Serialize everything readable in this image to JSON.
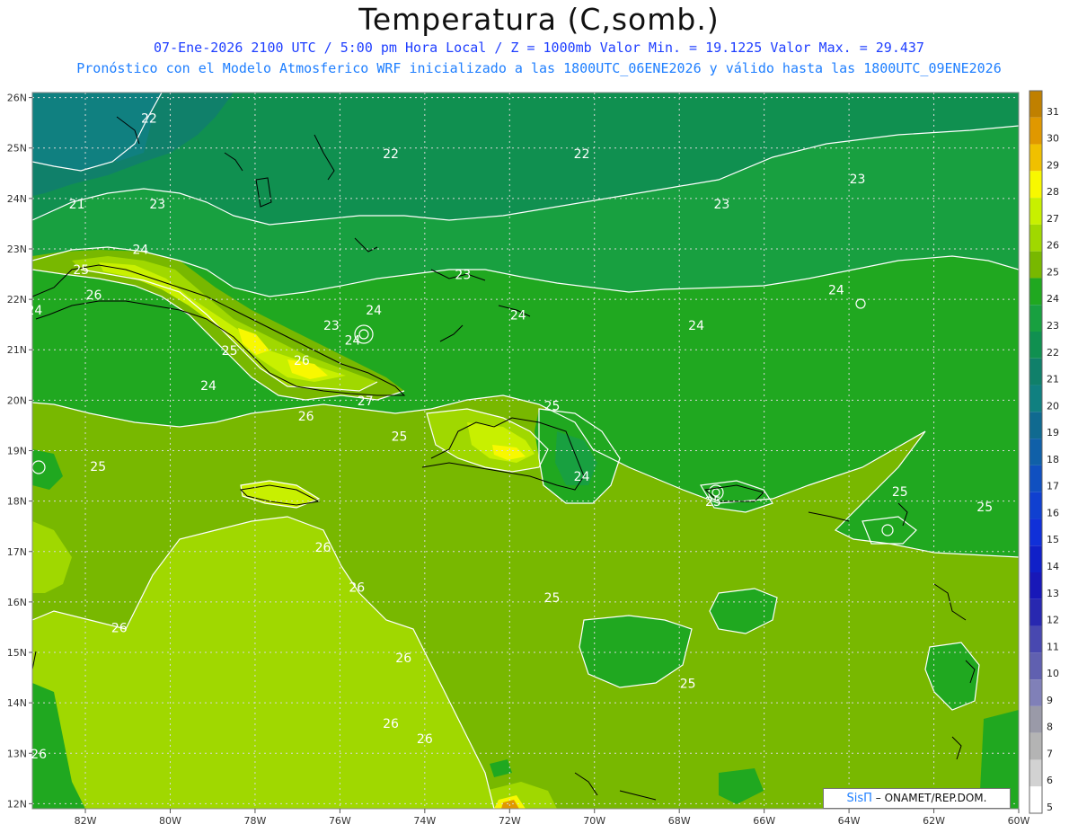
{
  "title": "Temperatura (C,somb.)",
  "subtitle_line1": "07-Ene-2026  2100 UTC / 5:00 pm Hora Local / Z = 1000mb    Valor Min. = 19.1225  Valor Max. = 29.437",
  "subtitle_line2": "Pronóstico con el Modelo Atmosferico WRF inicializado a las 1800UTC_06ENE2026 y válido hasta las  1800UTC_09ENE2026",
  "credit": {
    "brand": "SisΠ",
    "text": "– ONAMET/REP.DOM."
  },
  "lat_labels": [
    "26N",
    "25N",
    "24N",
    "23N",
    "22N",
    "21N",
    "20N",
    "19N",
    "18N",
    "17N",
    "16N",
    "15N",
    "14N",
    "13N",
    "12N"
  ],
  "lon_labels": [
    "82W",
    "80W",
    "78W",
    "76W",
    "74W",
    "72W",
    "70W",
    "68W",
    "66W",
    "64W",
    "62W",
    "60W"
  ],
  "colorbar": {
    "labels": [
      "31",
      "30",
      "29",
      "28",
      "27",
      "26",
      "25",
      "24",
      "23",
      "22",
      "21",
      "20",
      "19",
      "18",
      "17",
      "16",
      "15",
      "14",
      "13",
      "12",
      "11",
      "10",
      "9",
      "8",
      "7",
      "6",
      "5"
    ],
    "colors": [
      "#c08000",
      "#e09800",
      "#f0c000",
      "#f8f800",
      "#c8f000",
      "#a0d800",
      "#78b800",
      "#20a820",
      "#18a040",
      "#109050",
      "#10806a",
      "#108080",
      "#106a90",
      "#1060a8",
      "#1050c0",
      "#1040d0",
      "#1030d8",
      "#1020c8",
      "#1818b8",
      "#2828b0",
      "#4848b0",
      "#6060b0",
      "#8080b8",
      "#9a9aa8",
      "#b4b4b4",
      "#d2d2d2",
      "#ffffff"
    ]
  },
  "contour_labels": [
    {
      "t": "22",
      "lat": 25.5,
      "lon": -80.5
    },
    {
      "t": "22",
      "lat": 24.8,
      "lon": -74.8
    },
    {
      "t": "22",
      "lat": 24.8,
      "lon": -70.3
    },
    {
      "t": "21",
      "lat": 23.8,
      "lon": -82.2
    },
    {
      "t": "23",
      "lat": 23.8,
      "lon": -80.3
    },
    {
      "t": "23",
      "lat": 23.8,
      "lon": -67.0
    },
    {
      "t": "23",
      "lat": 24.3,
      "lon": -63.8
    },
    {
      "t": "23",
      "lat": 22.4,
      "lon": -73.1
    },
    {
      "t": "24",
      "lat": 22.9,
      "lon": -80.7
    },
    {
      "t": "25",
      "lat": 22.5,
      "lon": -82.1
    },
    {
      "t": "26",
      "lat": 22.0,
      "lon": -81.8
    },
    {
      "t": "24",
      "lat": 21.7,
      "lon": -83.2
    },
    {
      "t": "24",
      "lat": 22.1,
      "lon": -64.3
    },
    {
      "t": "24",
      "lat": 21.6,
      "lon": -71.8
    },
    {
      "t": "24",
      "lat": 21.4,
      "lon": -67.6
    },
    {
      "t": "23",
      "lat": 21.4,
      "lon": -76.2
    },
    {
      "t": "24",
      "lat": 21.1,
      "lon": -75.7
    },
    {
      "t": "24",
      "lat": 21.7,
      "lon": -75.2
    },
    {
      "t": "25",
      "lat": 20.9,
      "lon": -78.6
    },
    {
      "t": "26",
      "lat": 20.7,
      "lon": -76.9
    },
    {
      "t": "24",
      "lat": 20.2,
      "lon": -79.1
    },
    {
      "t": "27",
      "lat": 19.9,
      "lon": -75.4
    },
    {
      "t": "26",
      "lat": 19.6,
      "lon": -76.8
    },
    {
      "t": "25",
      "lat": 19.2,
      "lon": -74.6
    },
    {
      "t": "25",
      "lat": 19.8,
      "lon": -71.0
    },
    {
      "t": "24",
      "lat": 18.4,
      "lon": -70.3
    },
    {
      "t": "25",
      "lat": 17.9,
      "lon": -67.2
    },
    {
      "t": "25",
      "lat": 18.1,
      "lon": -62.8
    },
    {
      "t": "25",
      "lat": 17.8,
      "lon": -60.8
    },
    {
      "t": "25",
      "lat": 18.6,
      "lon": -81.7
    },
    {
      "t": "26",
      "lat": 17.0,
      "lon": -76.4
    },
    {
      "t": "26",
      "lat": 16.2,
      "lon": -75.6
    },
    {
      "t": "25",
      "lat": 16.0,
      "lon": -71.0
    },
    {
      "t": "26",
      "lat": 15.4,
      "lon": -81.2
    },
    {
      "t": "26",
      "lat": 14.8,
      "lon": -74.5
    },
    {
      "t": "25",
      "lat": 14.3,
      "lon": -67.8
    },
    {
      "t": "26",
      "lat": 13.5,
      "lon": -74.8
    },
    {
      "t": "26",
      "lat": 13.2,
      "lon": -74.0
    },
    {
      "t": "26",
      "lat": 12.9,
      "lon": -83.1
    }
  ]
}
